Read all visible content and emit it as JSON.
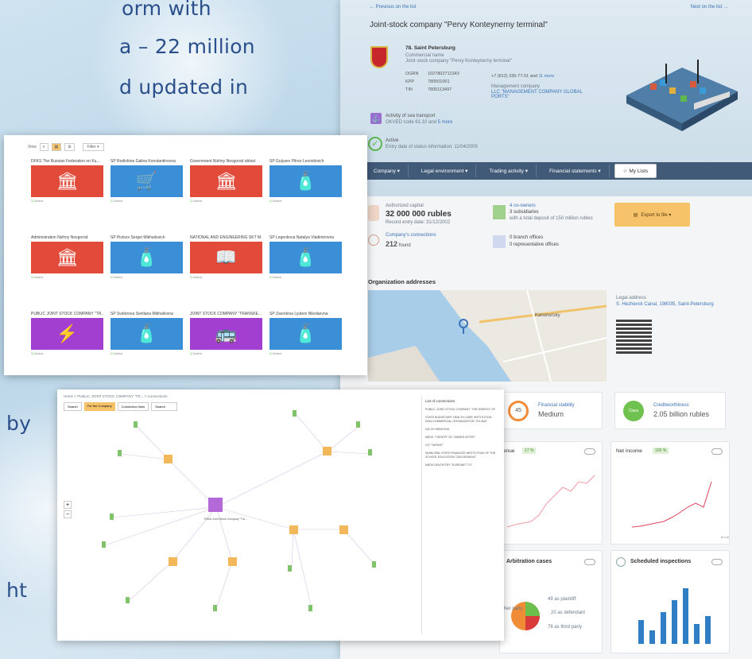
{
  "background_text": [
    "orm with",
    "a – 22 million",
    "d updated in",
    "by",
    "ht"
  ],
  "company": {
    "prev_link": "← Previous on the list",
    "next_link": "Next on the list →",
    "title": "Joint-stock company \"Pervy Konteynerny terminal\"",
    "region": "78. Saint Petersburg",
    "commercial_name_label": "Commercial name",
    "commercial_name": "Joint stock company \"Pervy Konteynerny terminal\"",
    "ids": [
      {
        "label": "OGRN",
        "value": "1027802712343"
      },
      {
        "label": "KPP",
        "value": "780501001"
      },
      {
        "label": "TIN",
        "value": "7805113497"
      }
    ],
    "phone": "+7 (812) 335-77-01 and",
    "phone_more": "11 more",
    "mgmt_label": "Management company",
    "mgmt_value": "LLC \"MANAGEMENT COMPANY GLOBAL PORTS\"",
    "activity_title": "Activity of sea transport",
    "activity_code": "OKVED code 61.10 and",
    "activity_more": "5 more",
    "status": "Active",
    "status_date": "Entry date of status information: 11/04/2005",
    "nav": [
      "Company ▾",
      "Legal environment ▾",
      "Trading activity ▾",
      "Financial statements ▾",
      "☆ My Lists"
    ],
    "capital_label": "Authorized capital",
    "capital_value": "32 000 000 rubles",
    "capital_date": "Record entry date: 31/12/2002",
    "coowners": "4 co-owners",
    "subsidiaries": "3 subsidiaries",
    "subsidiaries_note": "with a total deposit of 150 million rubles",
    "export_btn": "Export to file ▾",
    "connections_label": "Company's connections",
    "connections_value": "212",
    "connections_found": "found",
    "branch": "0 branch offices",
    "rep": "0 representative offices",
    "addresses_title": "Organization addresses",
    "map_street": "Kanonersky",
    "legal_address_label": "Legal address",
    "legal_address": "S. Hezhevsk Canal, 198035, Saint-Petersburg",
    "stability_score": "45",
    "stability_label": "Financial stability",
    "stability_value": "Medium",
    "credit_label": "Creditworthiness",
    "credit_value": "2.05 billion rubles",
    "credit_tag": "Class",
    "revenue_title": "enue",
    "revenue_badge": "17 %",
    "income_title": "Net income",
    "income_badge": "100 %",
    "income_unit": "th rub",
    "arb_title": "Arbitration cases",
    "arb_labels": [
      "49 as plaintiff",
      "20 as defendant",
      "76 as third party",
      "other party"
    ],
    "insp_title": "Scheduled inspections"
  },
  "grid": {
    "toolbar_view": "View",
    "toolbar_filter": "Filter ▾",
    "tiles": [
      {
        "title": "DFKS The Russian Federation on Ku...",
        "color": "#e24b3a",
        "icon": "🏛"
      },
      {
        "title": "SP Rodishina Galina Konstantinovna",
        "color": "#3a8fd6",
        "icon": "🛒"
      },
      {
        "title": "Government Nizhny Novgorod oblast",
        "color": "#e24b3a",
        "icon": "🏛"
      },
      {
        "title": "SP Gulyaev Pilnor Leonidovich",
        "color": "#3a8fd6",
        "icon": "🧴"
      },
      {
        "title": "Administration Nizhny Novgorod",
        "color": "#e24b3a",
        "icon": "🏛"
      },
      {
        "title": "SP Pivtsov Sergei Mikhailovich",
        "color": "#3a8fd6",
        "icon": "🧴"
      },
      {
        "title": "NATIONAL AND ENGINEERING SKT M...",
        "color": "#e24b3a",
        "icon": "📖"
      },
      {
        "title": "SP Legenkova Natalya Vladimirovna",
        "color": "#3a8fd6",
        "icon": "🧴"
      },
      {
        "title": "PUBLIC JOINT STOCK COMPANY \"TR...",
        "color": "#a23fd0",
        "icon": "⚡"
      },
      {
        "title": "SP Svidorova Svetlana Mikhailovna",
        "color": "#3a8fd6",
        "icon": "🧴"
      },
      {
        "title": "JOINT STOCK COMPANY \"TRANSKE...",
        "color": "#a23fd0",
        "icon": "🚌"
      },
      {
        "title": "SP Zavodova Lyubov Nikolaevna",
        "color": "#3a8fd6",
        "icon": "🧴"
      }
    ],
    "tile_status": "Active"
  },
  "graph": {
    "breadcrumb": "Home > PUBLIC JOINT STOCK COMPANY \"TR... > Connections",
    "tabs": [
      "Search",
      "For the Company",
      "Connection lines",
      "Search"
    ],
    "list_title": "List of connections",
    "list_items": [
      "PUBLIC JOINT STOCK COMPANY \"THE ENERGY OF",
      "STATE BUDGETARY HEALTH CARE INSTITUTION NON-COMMERCIAL ORGANIZATION \"GO AVA\"",
      "NIZ ZH MEDICINA",
      "MEDK \"TSENTR\" ZD \"AHMED ATTER\"",
      "OO \"TARHAT\"",
      "MUNICIPAL STATE FINANCED INSTITUTION OF THE SCHOOL EDUCATION \"ZAVODSKAYA\"",
      "MEDK DENTISTRY \"EVRIDNET TO\""
    ],
    "center_label": "Public Joint Stock Company \"Tra..."
  }
}
